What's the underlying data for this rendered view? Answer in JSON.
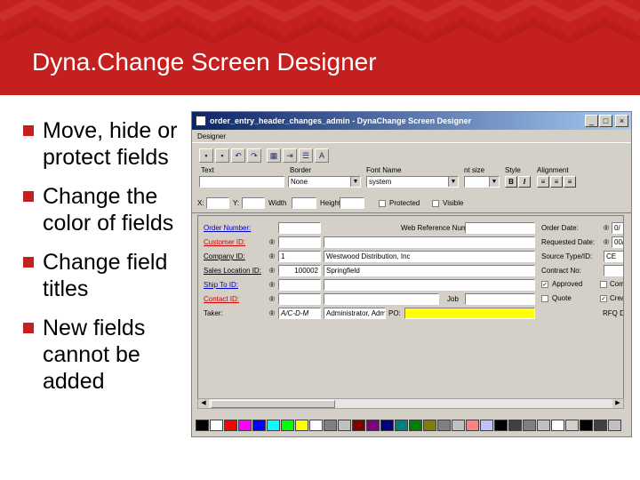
{
  "slide": {
    "title": "Dyna.Change Screen Designer",
    "accent_color": "#c3201f",
    "bullets": [
      "Move, hide or protect fields",
      "Change the color of fields",
      "Change field titles",
      "New fields cannot be added"
    ]
  },
  "window": {
    "title": "order_entry_header_changes_admin - DynaChange Screen Designer",
    "menu": [
      "Designer"
    ],
    "buttons": {
      "minimize": "_",
      "maximize": "□",
      "close": "×"
    },
    "toolbar": {
      "icons": [
        "save-icon",
        "save-as-icon",
        "undo-icon",
        "redo-icon",
        "grid-icon",
        "tab-order-icon",
        "properties-icon",
        "label-icon"
      ],
      "labels": {
        "text": "Text",
        "border": "Border",
        "font_name": "Font Name",
        "font_size": "nt size",
        "style": "Style",
        "alignment": "Alignment",
        "x": "X:",
        "y": "Y:",
        "width": "Width",
        "height": "Height",
        "protected": "Protected",
        "visible": "Visible"
      },
      "values": {
        "border": "None",
        "font_name": "system"
      },
      "style_buttons": [
        "B",
        "I"
      ],
      "align_buttons": [
        "≡",
        "≡",
        "≡"
      ]
    },
    "form": {
      "left_labels": [
        "Order Number:",
        "Customer ID:",
        "Company ID:",
        "Sales Location ID:",
        "Ship To ID:",
        "Contact ID:",
        "Taker:"
      ],
      "left_values": [
        "",
        "",
        "1",
        "100002",
        "",
        "",
        "A/C-D-M"
      ],
      "company_name": "Westwood Distribution, Inc",
      "sales_location_name": "Springfield",
      "taker_name": "Administrator, Admin",
      "po_label": "PO:",
      "job_label": "Job",
      "web_reference_label": "Web Reference Number:",
      "right_labels": [
        "Order Date:",
        "Requested Date:",
        "Source Type/ID:",
        "Contract No:",
        "Approved",
        "Quote",
        "RFQ"
      ],
      "right_values": [
        "0/",
        "00/",
        "CE"
      ],
      "far_right_labels": [
        "Comp",
        "Creat",
        "RFQ D"
      ],
      "highlight_color": "#ffff00"
    },
    "palette_colors": [
      "#000000",
      "#ffffff",
      "#ff0000",
      "#ff00ff",
      "#0000ff",
      "#00ffff",
      "#00ff00",
      "#ffff00",
      "#ffffff",
      "#808080",
      "#c0c0c0",
      "#800000",
      "#800080",
      "#000080",
      "#008080",
      "#008000",
      "#808000",
      "#808080",
      "#c0c0c0",
      "#ff8080",
      "#c0c0ff",
      "#000000",
      "#404040",
      "#808080",
      "#c0c0c0",
      "#ffffff",
      "#d4d0c8",
      "#000000",
      "#404040",
      "#c0c0c0"
    ]
  }
}
